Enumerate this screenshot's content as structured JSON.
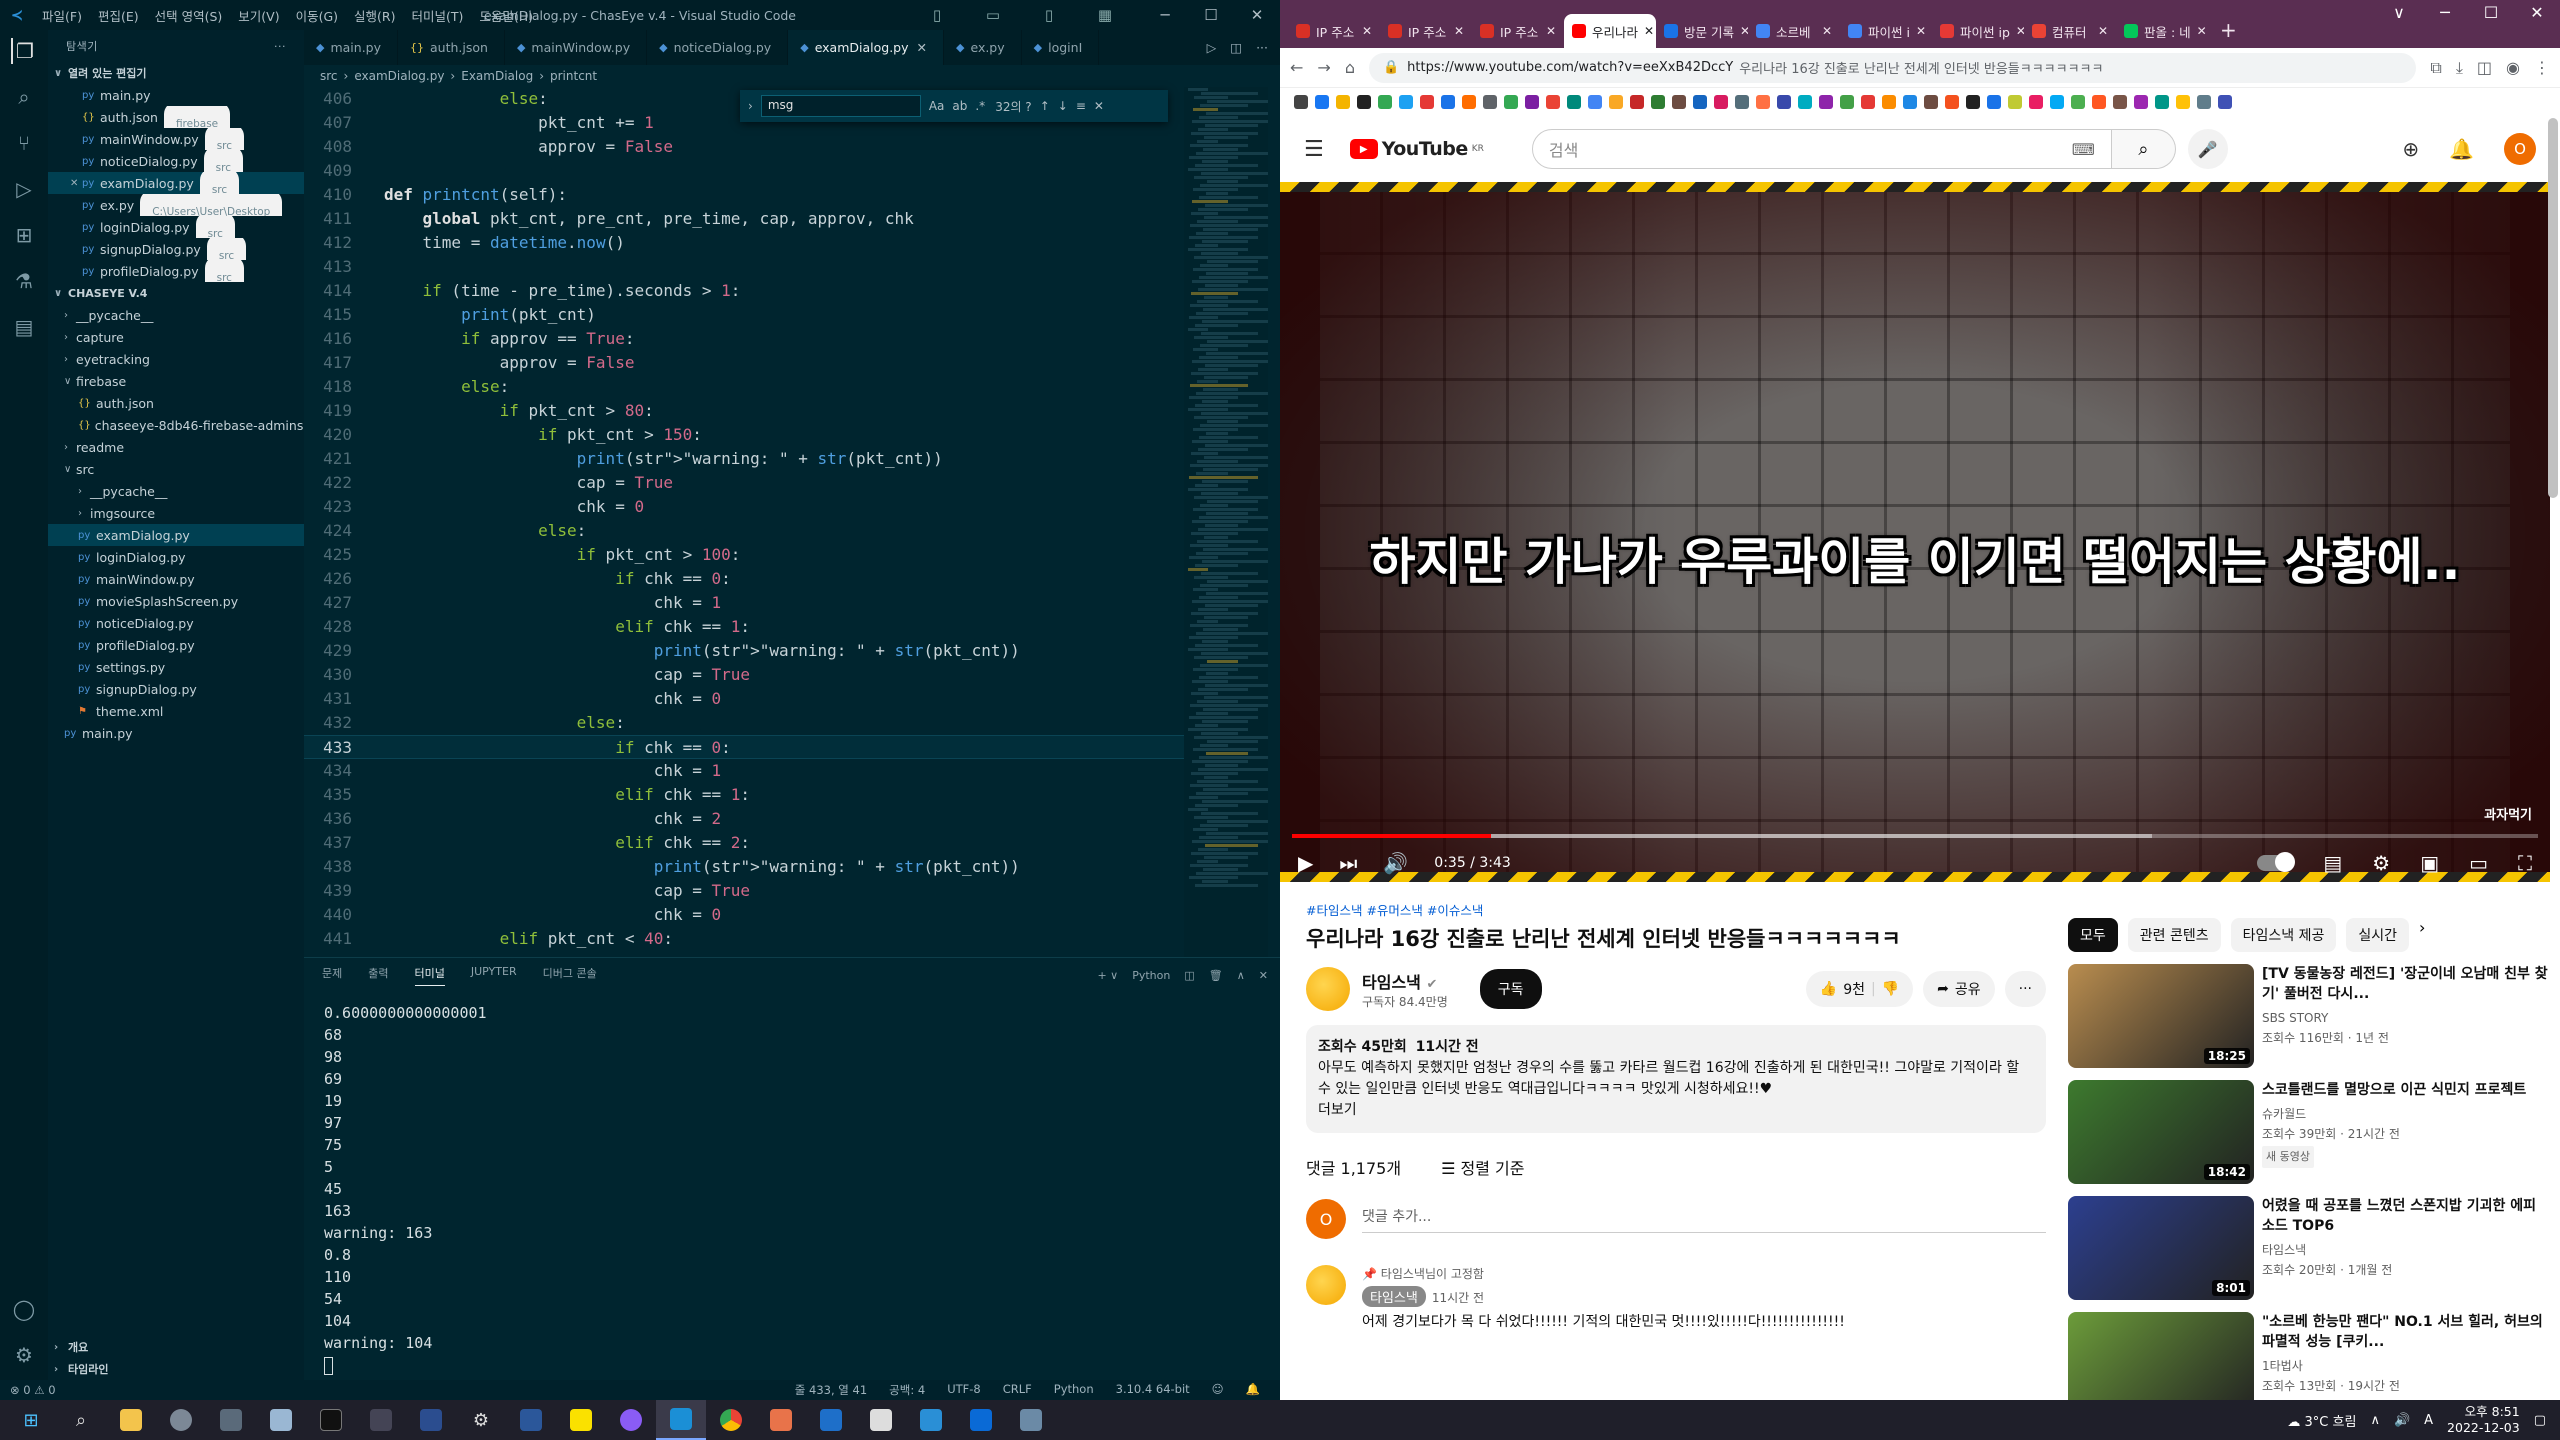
{
  "vscode": {
    "window_title": "examDialog.py - ChasEye v.4 - Visual Studio Code",
    "menu": [
      "파일(F)",
      "편집(E)",
      "선택 영역(S)",
      "보기(V)",
      "이동(G)",
      "실행(R)",
      "터미널(T)",
      "도움말(H)"
    ],
    "explorer_header": "탐색기",
    "open_editors_title": "열려 있는 편집기",
    "open_editors": [
      {
        "name": "main.py",
        "desc": ""
      },
      {
        "name": "auth.json",
        "desc": "firebase"
      },
      {
        "name": "mainWindow.py",
        "desc": "src"
      },
      {
        "name": "noticeDialog.py",
        "desc": "src"
      },
      {
        "name": "examDialog.py",
        "desc": "src"
      },
      {
        "name": "ex.py",
        "desc": "C:\\Users\\User\\Desktop"
      },
      {
        "name": "loginDialog.py",
        "desc": "src"
      },
      {
        "name": "signupDialog.py",
        "desc": "src"
      },
      {
        "name": "profileDialog.py",
        "desc": "src"
      }
    ],
    "project_title": "CHASEYE V.4",
    "tree": [
      {
        "name": "__pycache__",
        "type": "folder",
        "depth": 0,
        "open": false
      },
      {
        "name": "capture",
        "type": "folder",
        "depth": 0,
        "open": false
      },
      {
        "name": "eyetracking",
        "type": "folder",
        "depth": 0,
        "open": false
      },
      {
        "name": "firebase",
        "type": "folder",
        "depth": 0,
        "open": true
      },
      {
        "name": "auth.json",
        "type": "json",
        "depth": 1
      },
      {
        "name": "chaseeye-8db46-firebase-adminsd...",
        "type": "json",
        "depth": 1
      },
      {
        "name": "readme",
        "type": "folder",
        "depth": 0,
        "open": false
      },
      {
        "name": "src",
        "type": "folder",
        "depth": 0,
        "open": true
      },
      {
        "name": "__pycache__",
        "type": "folder",
        "depth": 1,
        "open": false
      },
      {
        "name": "imgsource",
        "type": "folder",
        "depth": 1,
        "open": false
      },
      {
        "name": "examDialog.py",
        "type": "py",
        "depth": 1
      },
      {
        "name": "loginDialog.py",
        "type": "py",
        "depth": 1
      },
      {
        "name": "mainWindow.py",
        "type": "py",
        "depth": 1
      },
      {
        "name": "movieSplashScreen.py",
        "type": "py",
        "depth": 1
      },
      {
        "name": "noticeDialog.py",
        "type": "py",
        "depth": 1
      },
      {
        "name": "profileDialog.py",
        "type": "py",
        "depth": 1
      },
      {
        "name": "settings.py",
        "type": "py",
        "depth": 1
      },
      {
        "name": "signupDialog.py",
        "type": "py",
        "depth": 1
      },
      {
        "name": "theme.xml",
        "type": "xml",
        "depth": 1
      },
      {
        "name": "main.py",
        "type": "py",
        "depth": 0
      }
    ],
    "outline_label": "개요",
    "timeline_label": "타임라인",
    "tabs": [
      "main.py",
      "auth.json",
      "mainWindow.py",
      "noticeDialog.py",
      "examDialog.py",
      "ex.py",
      "loginI"
    ],
    "active_tab": "examDialog.py",
    "breadcrumb": [
      "src",
      "examDialog.py",
      "ExamDialog",
      "printcnt"
    ],
    "find": {
      "query": "msg",
      "count": "32의 ?"
    },
    "code": [
      {
        "n": "406",
        "t": "            else:"
      },
      {
        "n": "407",
        "t": "                pkt_cnt += 1"
      },
      {
        "n": "408",
        "t": "                approv = False"
      },
      {
        "n": "409",
        "t": ""
      },
      {
        "n": "410",
        "t": "def printcnt(self):"
      },
      {
        "n": "411",
        "t": "    global pkt_cnt, pre_cnt, pre_time, cap, approv, chk"
      },
      {
        "n": "412",
        "t": "    time = datetime.now()"
      },
      {
        "n": "413",
        "t": ""
      },
      {
        "n": "414",
        "t": "    if (time - pre_time).seconds > 1:"
      },
      {
        "n": "415",
        "t": "        print(pkt_cnt)"
      },
      {
        "n": "416",
        "t": "        if approv == True:"
      },
      {
        "n": "417",
        "t": "            approv = False"
      },
      {
        "n": "418",
        "t": "        else:"
      },
      {
        "n": "419",
        "t": "            if pkt_cnt > 80:"
      },
      {
        "n": "420",
        "t": "                if pkt_cnt > 150:"
      },
      {
        "n": "421",
        "t": "                    print(\"warning: \" + str(pkt_cnt))"
      },
      {
        "n": "422",
        "t": "                    cap = True"
      },
      {
        "n": "423",
        "t": "                    chk = 0"
      },
      {
        "n": "424",
        "t": "                else:"
      },
      {
        "n": "425",
        "t": "                    if pkt_cnt > 100:"
      },
      {
        "n": "426",
        "t": "                        if chk == 0:"
      },
      {
        "n": "427",
        "t": "                            chk = 1"
      },
      {
        "n": "428",
        "t": "                        elif chk == 1:"
      },
      {
        "n": "429",
        "t": "                            print(\"warning: \" + str(pkt_cnt))"
      },
      {
        "n": "430",
        "t": "                            cap = True"
      },
      {
        "n": "431",
        "t": "                            chk = 0"
      },
      {
        "n": "432",
        "t": "                    else:"
      },
      {
        "n": "433",
        "t": "                        if chk == 0:"
      },
      {
        "n": "434",
        "t": "                            chk = 1"
      },
      {
        "n": "435",
        "t": "                        elif chk == 1:"
      },
      {
        "n": "436",
        "t": "                            chk = 2"
      },
      {
        "n": "437",
        "t": "                        elif chk == 2:"
      },
      {
        "n": "438",
        "t": "                            print(\"warning: \" + str(pkt_cnt))"
      },
      {
        "n": "439",
        "t": "                            cap = True"
      },
      {
        "n": "440",
        "t": "                            chk = 0"
      },
      {
        "n": "441",
        "t": "            elif pkt_cnt < 40:"
      }
    ],
    "current_line": "433",
    "panel_tabs": [
      "문제",
      "출력",
      "터미널",
      "JUPYTER",
      "디버그 콘솔"
    ],
    "active_panel": "터미널",
    "terminal_shell": "Python",
    "terminal": [
      "0.6000000000000001",
      "68",
      "98",
      "69",
      "19",
      "97",
      "75",
      "5",
      "45",
      "163",
      "warning: 163",
      "0.8",
      "110",
      "54",
      "104",
      "warning: 104"
    ],
    "status": {
      "problems": "⊗ 0 ⚠ 0",
      "position": "줄 433, 열 41",
      "spaces": "공백: 4",
      "encoding": "UTF-8",
      "eol": "CRLF",
      "language": "Python",
      "interpreter": "3.10.4 64-bit"
    }
  },
  "chrome": {
    "tabs": [
      "IP 주소",
      "IP 주소",
      "IP 주소",
      "우리나라",
      "방문 기록",
      "소르베",
      "파이썬 i",
      "파이썬 ip",
      "컴퓨터",
      "판올 : 네"
    ],
    "active_tab_index": 3,
    "url": "https://www.youtube.com/watch?v=eeXxB42DccY",
    "url_title": "우리나라 16강 진출로 난리난 전세계 인터넷 반응들ㅋㅋㅋㅋㅋㅋㅋ"
  },
  "youtube": {
    "logo_text": "YouTube",
    "logo_region": "KR",
    "search_placeholder": "검색",
    "avatar_letter": "O",
    "subtitle": "하지만 가나가 우루과이를 이기면 떨어지는 상황에..",
    "watermark": "과자먹기",
    "time": "0:35 / 3:43",
    "progress": 0.16,
    "buffered": 0.69,
    "hashtags": "#타임스낵 #유머스낵 #이슈스낵",
    "title": "우리나라 16강 진출로 난리난 전세계 인터넷 반응들ㅋㅋㅋㅋㅋㅋㅋ",
    "channel": "타임스낵",
    "subscribers": "구독자 84.4만명",
    "subscribe_label": "구독",
    "likes": "9천",
    "share_label": "공유",
    "views": "조회수 45만회",
    "posted": "11시간 전",
    "description": "아무도 예측하지 못했지만 엄청난 경우의 수를 뚫고 카타르 월드컵 16강에 진출하게 된 대한민국!! 그야말로 기적이라 할 수 있는 일인만큼 인터넷 반응도 역대급입니다ㅋㅋㅋㅋ 맛있게 시청하세요!!♥",
    "more_label": "더보기",
    "comment_count": "댓글 1,175개",
    "sort_label": "정렬 기준",
    "add_comment": "댓글 추가...",
    "pinned_comment": {
      "pin_label": "타임스낵님이 고정함",
      "author": "타임스낵",
      "time": "11시간 전",
      "text": "어제 경기보다가 목 다 쉬었다!!!!!! 기적의 대한민국 멋!!!!있!!!!!다!!!!!!!!!!!!!!!"
    },
    "chips": [
      "모두",
      "관련 콘텐츠",
      "타임스낵 제공",
      "실시간"
    ],
    "recommendations": [
      {
        "title": "[TV 동물농장 레전드] '장군이네 오남매 친부 찾기' 풀버전 다시...",
        "channel": "SBS STORY",
        "meta": "조회수 116만회 · 1년 전",
        "duration": "18:25",
        "color": "#b98d4f",
        "badge": ""
      },
      {
        "title": "스코틀랜드를 멸망으로 이끈 식민지 프로젝트",
        "channel": "슈카월드",
        "meta": "조회수 39만회 · 21시간 전",
        "duration": "18:42",
        "color": "#3d7a2e",
        "badge": "새 동영상"
      },
      {
        "title": "어렸을 때 공포를 느꼈던 스폰지밥 기괴한 에피소드 TOP6",
        "channel": "타임스낵",
        "meta": "조회수 20만회 · 1개월 전",
        "duration": "8:01",
        "color": "#2c3f8f",
        "badge": ""
      },
      {
        "title": "\"소르베 한능만 팬다\" NO.1 서브 힐러, 허브의 파멸적 성능 [쿠키...",
        "channel": "1타법사",
        "meta": "조회수 13만회 · 19시간 전",
        "duration": "",
        "color": "#6c9c3a",
        "badge": ""
      }
    ]
  },
  "taskbar": {
    "weather": "3°C 흐림",
    "time": "오후 8:51",
    "date": "2022-12-03"
  }
}
